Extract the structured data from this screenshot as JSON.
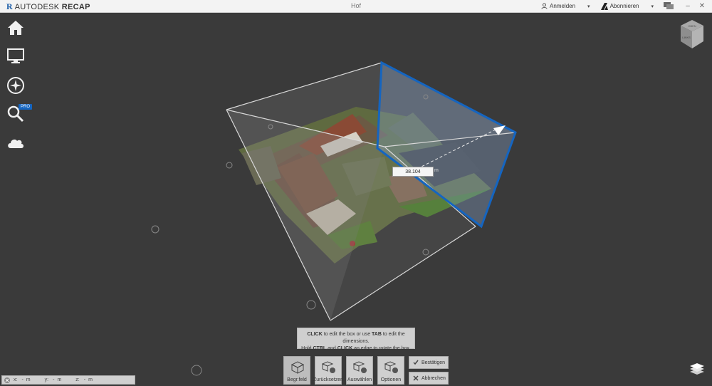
{
  "titlebar": {
    "brand_mark": "R",
    "brand_name_regular": "AUTODESK",
    "brand_name_bold": "RECAP",
    "document_title": "Hof",
    "signin_label": "Anmelden",
    "subscribe_label": "Abonnieren",
    "minimize_symbol": "–",
    "close_symbol": "✕",
    "caret": "▾"
  },
  "sidebar": {
    "items": [
      {
        "name": "home-icon"
      },
      {
        "name": "monitor-icon"
      },
      {
        "name": "compass-icon"
      },
      {
        "name": "search-icon"
      },
      {
        "name": "cloud-icon"
      }
    ],
    "pro_badge": "PRO"
  },
  "viewcube": {
    "top_label": "OBEN",
    "front_label": "LINKS"
  },
  "measurement": {
    "value": "38.104",
    "unit": "m"
  },
  "tooltip": {
    "line1_a": "CLICK",
    "line1_b": " to edit the box or use ",
    "line1_c": "TAB",
    "line1_d": " to edit the dimensions.",
    "line2_a": "Hold ",
    "line2_b": "CTRL",
    "line2_c": " and ",
    "line2_d": "CLICK",
    "line2_e": " an edge to rotate the box."
  },
  "toolbar": {
    "tools": [
      {
        "label": "Begr.feld"
      },
      {
        "label": "Zurücksetzen"
      },
      {
        "label": "Auswählen"
      },
      {
        "label": "Optionen"
      }
    ],
    "confirm_label": "Bestätigen",
    "cancel_label": "Abbrechen"
  },
  "coordinates": {
    "x_label": "x:",
    "x_value": "-",
    "x_unit": "m",
    "y_label": "y:",
    "y_value": "-",
    "y_unit": "m",
    "z_label": "z:",
    "z_value": "-",
    "z_unit": "m"
  },
  "colors": {
    "accent_blue": "#1565c0",
    "viewport_bg": "#3a3a3a",
    "panel_gray": "#cfcfcf"
  }
}
